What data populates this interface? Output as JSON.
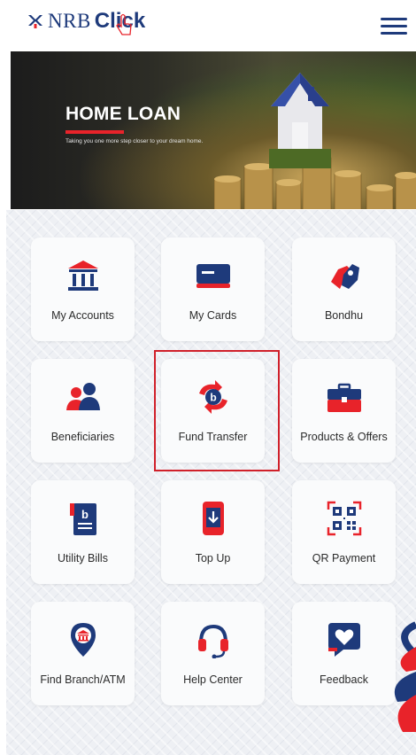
{
  "header": {
    "logo_nrb": "NRB",
    "logo_click": "Click",
    "menu_icon": "hamburger-menu-icon"
  },
  "banner": {
    "title": "HOME LOAN",
    "subtitle": "Taking you one more step closer to your dream home.",
    "slide_count": 4,
    "active_slide": 3
  },
  "tiles": [
    {
      "label": "My Accounts",
      "icon": "bank-icon"
    },
    {
      "label": "My Cards",
      "icon": "card-icon"
    },
    {
      "label": "Bondhu",
      "icon": "bondhu-icon"
    },
    {
      "label": "Beneficiaries",
      "icon": "people-icon"
    },
    {
      "label": "Fund Transfer",
      "icon": "transfer-icon"
    },
    {
      "label": "Products & Offers",
      "icon": "briefcase-icon"
    },
    {
      "label": "Utility Bills",
      "icon": "bill-icon"
    },
    {
      "label": "Top Up",
      "icon": "mobile-topup-icon"
    },
    {
      "label": "QR Payment",
      "icon": "qr-code-icon"
    },
    {
      "label": "Find Branch/ATM",
      "icon": "location-pin-icon"
    },
    {
      "label": "Help Center",
      "icon": "headset-icon"
    },
    {
      "label": "Feedback",
      "icon": "feedback-heart-icon"
    }
  ],
  "colors": {
    "brand_blue": "#1e3a7b",
    "brand_red": "#e8232a",
    "highlight_red": "#d0202a"
  }
}
